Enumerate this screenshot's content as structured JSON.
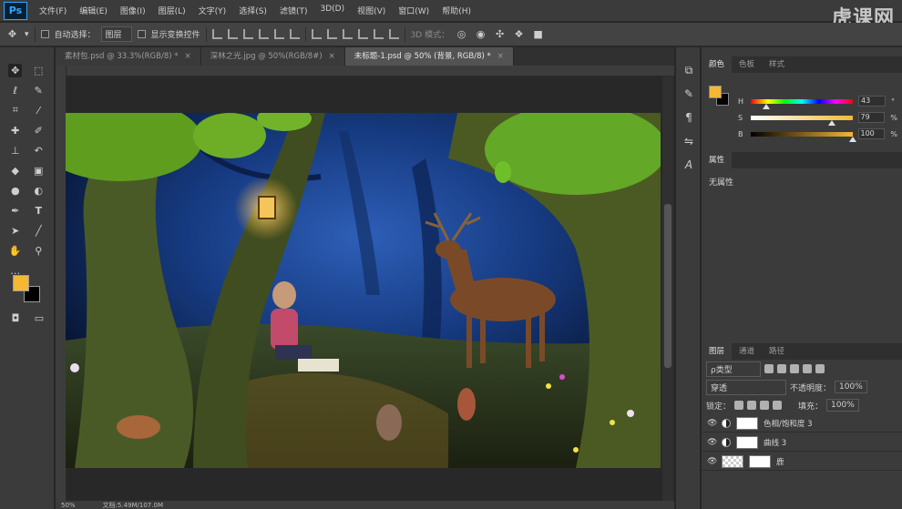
{
  "app": {
    "logo": "Ps",
    "watermark": "虎课网"
  },
  "menu": [
    "文件(F)",
    "编辑(E)",
    "图像(I)",
    "图层(L)",
    "文字(Y)",
    "选择(S)",
    "滤镜(T)",
    "3D(D)",
    "视图(V)",
    "窗口(W)",
    "帮助(H)"
  ],
  "options": {
    "auto_select_label": "自动选择：",
    "auto_select_value": "图层",
    "show_transform_label": "显示变换控件",
    "mode_3d": "3D 模式："
  },
  "doc_tabs": [
    {
      "label": "素材包.psd @ 33.3%(RGB/8) *",
      "active": false
    },
    {
      "label": "深林之光.jpg @ 50%(RGB/8#)",
      "active": false
    },
    {
      "label": "未标题-1.psd @ 50% (背景, RGB/8) *",
      "active": true
    }
  ],
  "tab_close": "×",
  "status": {
    "zoom": "50%",
    "doc_info": "文档:5.49M/107.0M"
  },
  "color_panel": {
    "tabs": [
      "颜色",
      "色板",
      "样式"
    ],
    "fg": "#f5b835",
    "bg": "#000000",
    "sliders": [
      {
        "label": "H",
        "value": "43",
        "unit": "°",
        "level": 0.12
      },
      {
        "label": "S",
        "value": "79",
        "unit": "%",
        "level": 0.79
      },
      {
        "label": "B",
        "value": "100",
        "unit": "%",
        "level": 1.0
      }
    ]
  },
  "props_panel": {
    "tab": "属性",
    "content": "无属性"
  },
  "layers_panel": {
    "tabs": [
      "图层",
      "通道",
      "路径"
    ],
    "filter_kind": "ρ类型",
    "blend_mode": "穿透",
    "opacity_label": "不透明度：",
    "opacity_value": "100%",
    "lock_label": "锁定：",
    "fill_label": "填充：",
    "fill_value": "100%",
    "layers": [
      {
        "name": "色相/饱和度 3"
      },
      {
        "name": "曲线 3"
      },
      {
        "name": "鹿"
      }
    ]
  },
  "colors": {
    "accent": "#31a8ff",
    "foreground": "#f5b835"
  }
}
